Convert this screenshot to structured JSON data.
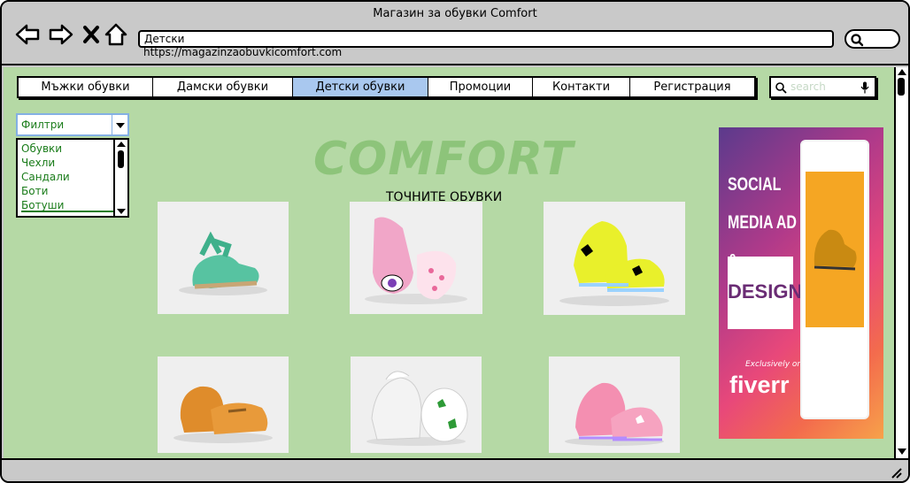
{
  "window": {
    "title": "Магазин за обувки Comfort"
  },
  "browser": {
    "address_value": "Детски",
    "url": "https://magazinzaobuvkicomfort.com"
  },
  "nav": {
    "items": [
      {
        "label": "Мъжки обувки",
        "active": false
      },
      {
        "label": "Дамски обувки",
        "active": false
      },
      {
        "label": "Детски обувки",
        "active": true
      },
      {
        "label": "Промоции",
        "active": false
      },
      {
        "label": "Контакти",
        "active": false
      },
      {
        "label": "Регистрация",
        "active": false
      }
    ]
  },
  "search": {
    "placeholder": "search"
  },
  "filters": {
    "selected": "Филтри",
    "options": [
      "Обувки",
      "Чехли",
      "Сандали",
      "Боти",
      "Ботуши"
    ]
  },
  "brand": {
    "name": "COMFORT",
    "tagline": "ТОЧНИТЕ ОБУВКИ"
  },
  "products": [
    {
      "kind": "green-sandal"
    },
    {
      "kind": "pink-glitter-sneaker"
    },
    {
      "kind": "yellow-light-sneaker"
    },
    {
      "kind": "tan-moccasin"
    },
    {
      "kind": "white-lace-shoe"
    },
    {
      "kind": "pink-light-sneaker"
    }
  ],
  "ad": {
    "headline": "SOCIAL MEDIA AD & BANNER",
    "design": "DESIGN",
    "exclusive": "Exclusively on",
    "fiverr": "fiverr"
  },
  "colors": {
    "page_bg": "#b5d9a5",
    "active_tab": "#a9c8ef",
    "brand_text": "#8dc47a",
    "filter_text": "#1a7c1a"
  }
}
